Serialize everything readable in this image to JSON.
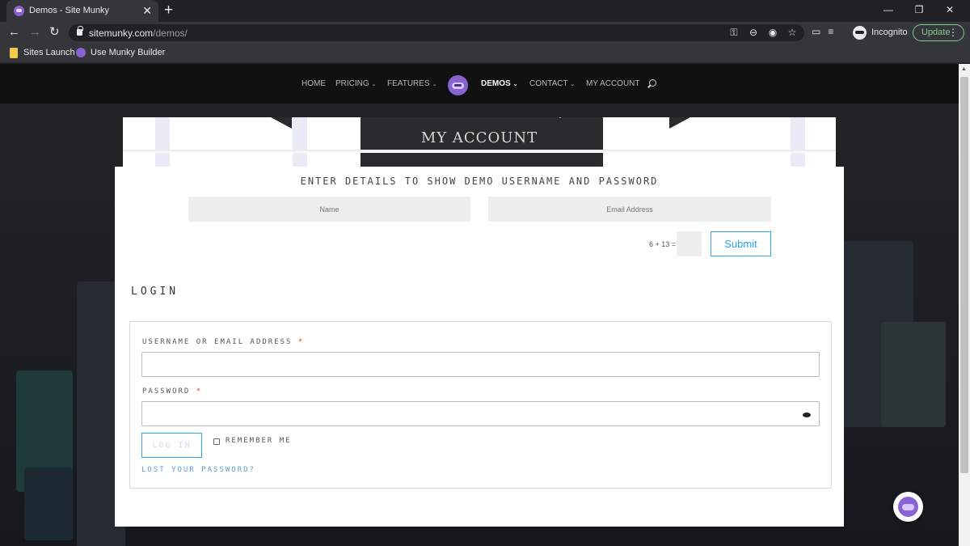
{
  "browser": {
    "tab_title": "Demos - Site Munky",
    "tab_close": "✕",
    "new_tab": "+",
    "window_controls": [
      "—",
      "❐",
      "✕"
    ],
    "url_host": "sitemunky.com",
    "url_path": "/demos/",
    "omnibox_icons": [
      "key-icon",
      "zoom-icon",
      "eye-off-icon",
      "star-icon"
    ],
    "toolbar_icons": [
      "cast-icon",
      "media-icon"
    ],
    "profile_label": "Incognito",
    "update_label": "Update",
    "bookmarks": [
      {
        "label": "Sites Launch",
        "icon": "folder-icon"
      },
      {
        "label": "Use Munky Builder",
        "icon": "munky-icon"
      }
    ]
  },
  "site": {
    "nav": [
      {
        "label": "HOME",
        "dropdown": false
      },
      {
        "label": "PRICING",
        "dropdown": true
      },
      {
        "label": "FEATURES",
        "dropdown": true
      },
      {
        "label": "DEMOS",
        "dropdown": true,
        "active": true
      },
      {
        "label": "CONTACT",
        "dropdown": true
      },
      {
        "label": "MY ACCOUNT",
        "dropdown": false
      }
    ],
    "chevron": "⌄",
    "banner_title": "MY ACCOUNT",
    "demo_form": {
      "heading": "ENTER DETAILS TO SHOW DEMO USERNAME AND PASSWORD",
      "name_placeholder": "Name",
      "email_placeholder": "Email Address",
      "captcha_label": "6 + 13 =",
      "submit_label": "Submit"
    },
    "login": {
      "heading": "LOGIN",
      "username_label": "USERNAME OR EMAIL ADDRESS",
      "password_label": "PASSWORD",
      "required_mark": "*",
      "login_button": "LOG IN",
      "remember_label": "REMEMBER ME",
      "lost_password": "LOST YOUR PASSWORD?"
    }
  },
  "colors": {
    "accent": "#2ea3f2",
    "brand": "#8a63d2",
    "required": "#e2401c",
    "update": "#81c995"
  }
}
